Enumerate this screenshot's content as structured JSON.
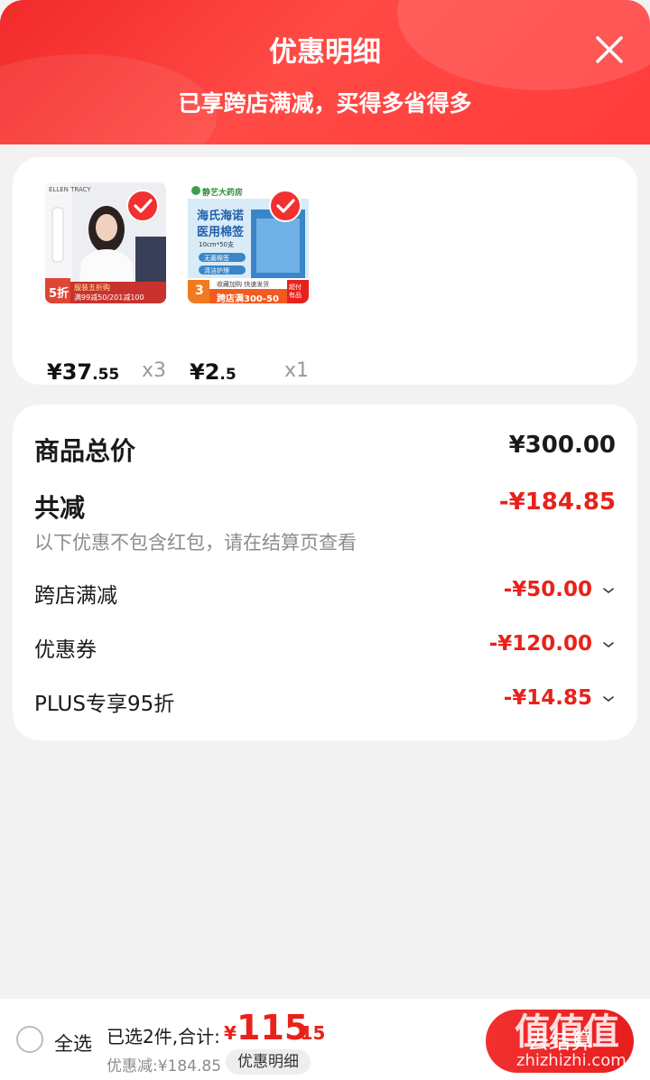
{
  "header": {
    "title": "优惠明细",
    "subtitle": "已享跨店满减，买得多省得多",
    "close_icon": "close-icon"
  },
  "products": [
    {
      "image": "product-image-apparel",
      "price_int": "¥37",
      "price_dec": ".55",
      "qty": "x3"
    },
    {
      "image": "product-image-pharmacy",
      "price_int": "¥2",
      "price_dec": ".5",
      "qty": "x1"
    }
  ],
  "product1_badges": {
    "brand": "ELLEN TRACY",
    "discount_tag": "5折",
    "promo_title": "服装五折购",
    "promo_text": "满99减50/201减100"
  },
  "product2_badges": {
    "store": "静艺大药房",
    "name_line1": "海氏海诺",
    "name_line2": "医用棉签",
    "spec": "10cm*50支",
    "tag1": "无菌棉签",
    "tag2": "清洁护理",
    "count_tag": "3",
    "promo_title": "收藏加购 快速发货",
    "promo_text": "跨店满300-50",
    "side_tag": "超付 有品"
  },
  "summary": {
    "total_label": "商品总价",
    "total_value": "¥300.00",
    "reduce_label": "共减",
    "reduce_value": "-¥184.85",
    "note": "以下优惠不包含红包，请在结算页查看",
    "items": [
      {
        "label": "跨店满减",
        "value": "-¥50.00"
      },
      {
        "label": "优惠券",
        "value": "-¥120.00"
      },
      {
        "label": "PLUS专享95折",
        "value": "-¥14.85"
      }
    ]
  },
  "bottom": {
    "select_all": "全选",
    "selected_text": "已选2件,合计:",
    "total_currency": "¥",
    "total_int": "115",
    "total_dec": ".15",
    "discount_text": "优惠减:¥184.85",
    "detail_button": "优惠明细",
    "checkout_button": "去结算"
  },
  "watermark": {
    "logo_text": "值值值",
    "site": "zhizhizhi.com"
  },
  "colors": {
    "accent": "#e8221b",
    "header_start": "#f22a2a",
    "header_end": "#ff3b3b"
  }
}
